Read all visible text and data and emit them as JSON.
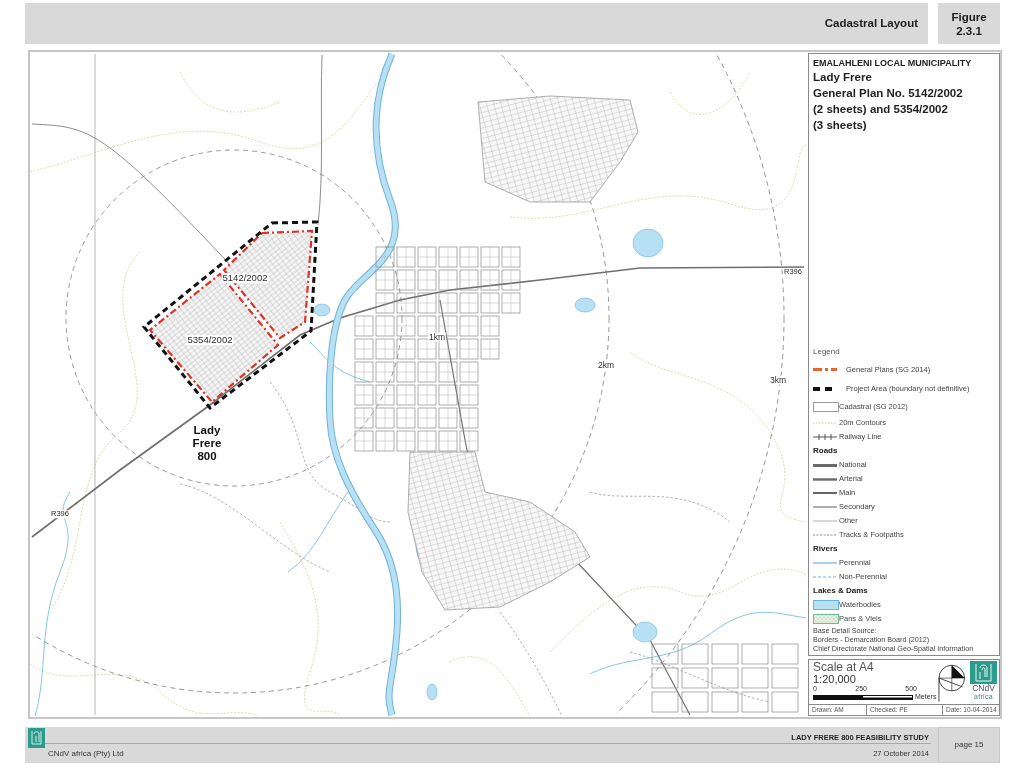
{
  "header": {
    "title": "Cadastral Layout",
    "figure_label": "Figure",
    "figure_number": "2.3.1"
  },
  "map": {
    "labels": [
      {
        "kind": "plan",
        "text": "5142/2002"
      },
      {
        "kind": "plan",
        "text": "5354/2002"
      },
      {
        "kind": "place",
        "text": "Lady Frere 800"
      },
      {
        "kind": "ring",
        "text": "1km"
      },
      {
        "kind": "ring",
        "text": "2km"
      },
      {
        "kind": "ring",
        "text": "3km"
      },
      {
        "kind": "road",
        "text": "R396"
      },
      {
        "kind": "road",
        "text": "R396"
      }
    ]
  },
  "title_block": {
    "authority": "EMALAHLENI LOCAL MUNICIPALITY",
    "place": "Lady Frere",
    "plan_lines": [
      "General Plan No. 5142/2002",
      "(2 sheets) and 5354/2002",
      "(3 sheets)"
    ]
  },
  "legend": {
    "heading": "Legend",
    "items": [
      {
        "kind": "plan",
        "label": "General Plans (SG 2014)"
      },
      {
        "kind": "project",
        "label": "Project Area (boundary not definitive)"
      },
      {
        "kind": "cadastral",
        "label": "Cadastral (SG 2012)"
      },
      {
        "kind": "contour",
        "label": "20m Contours"
      },
      {
        "kind": "railway",
        "label": "Railway Line"
      },
      {
        "kind": "heading",
        "label": "Roads"
      },
      {
        "kind": "national",
        "label": "National"
      },
      {
        "kind": "arterial",
        "label": "Arterial"
      },
      {
        "kind": "main",
        "label": "Main"
      },
      {
        "kind": "secondary",
        "label": "Secondary"
      },
      {
        "kind": "other",
        "label": "Other"
      },
      {
        "kind": "track",
        "label": "Tracks & Footpaths"
      },
      {
        "kind": "heading",
        "label": "Rivers"
      },
      {
        "kind": "perennial",
        "label": "Perennial"
      },
      {
        "kind": "nonperennial",
        "label": "Non-Perennial"
      },
      {
        "kind": "heading",
        "label": "Lakes & Dams"
      },
      {
        "kind": "waterbody",
        "label": "Waterbodies"
      },
      {
        "kind": "pan",
        "label": "Pans & Vleis"
      }
    ],
    "source": {
      "title": "Base Detail Source:",
      "lines": [
        "Borders - Demarcation Board (2012)",
        "Chief Directorate National Geo-Spatial Information"
      ]
    }
  },
  "scale": {
    "title": "Scale at A4",
    "ratio": "1:20,000",
    "ticks": [
      "0",
      "250",
      "500"
    ],
    "unit": "Meters"
  },
  "logo": {
    "name": "CNdV",
    "tagline": "africa"
  },
  "sign_off": [
    "Drawn: AM",
    "Checked: PE",
    "Date: 10-04-2014"
  ],
  "footer": {
    "company": "CNdV africa (Pty) Ltd",
    "study": "LADY FRERE 800 FEASIBILITY STUDY",
    "date": "27 October 2014",
    "page": "page 15"
  }
}
